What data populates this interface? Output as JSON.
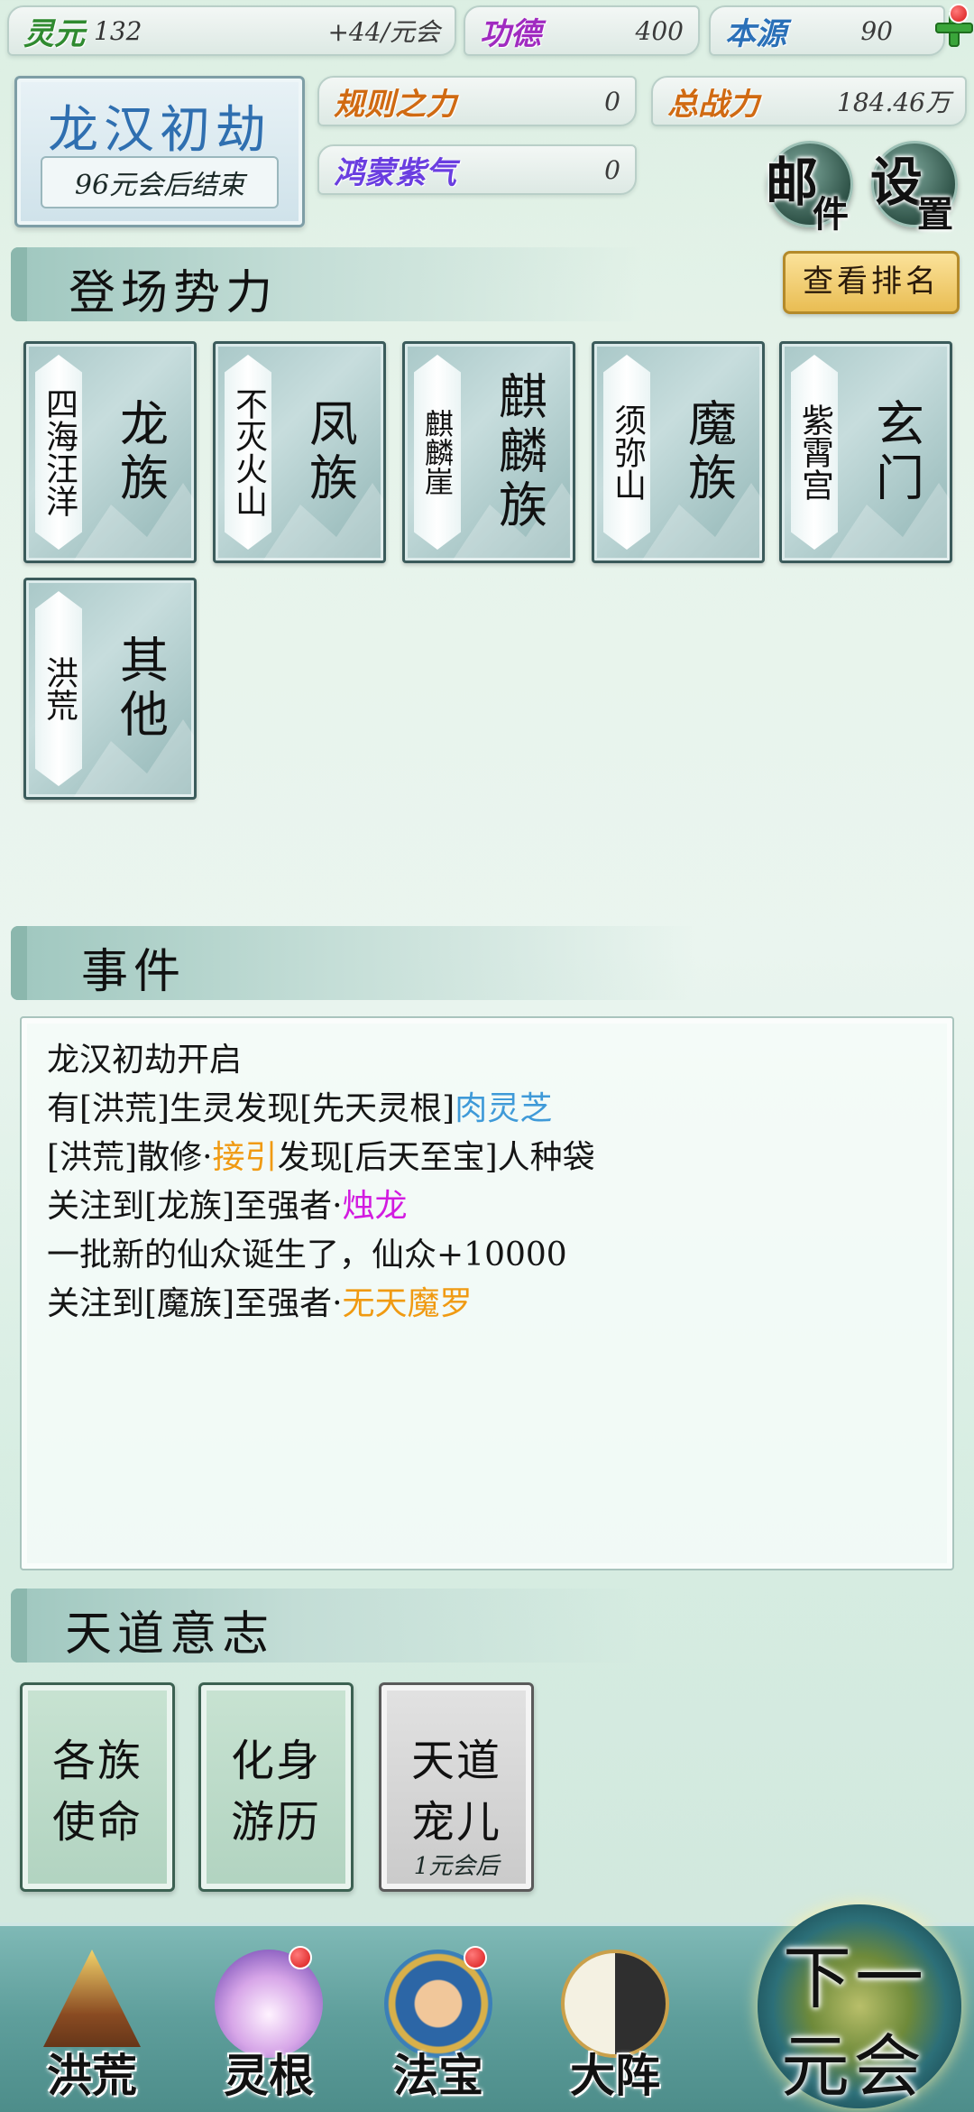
{
  "top": {
    "lingyuan": {
      "label": "灵元",
      "value": "132",
      "rate": "+44/元会"
    },
    "gongde": {
      "label": "功德",
      "value": "400"
    },
    "benyuan": {
      "label": "本源",
      "value": "90"
    },
    "guize": {
      "label": "规则之力",
      "value": "0"
    },
    "zhanli": {
      "label": "总战力",
      "value": "184.46万"
    },
    "hongmeng": {
      "label": "鸿蒙紫气",
      "value": "0"
    }
  },
  "era": {
    "title": "龙汉初劫",
    "subtitle": "96元会后结束"
  },
  "buttons": {
    "mail": [
      "邮",
      "件"
    ],
    "settings": [
      "设",
      "置"
    ]
  },
  "factions_section": {
    "title": "登场势力",
    "rank_button": "查看排名"
  },
  "factions": [
    {
      "location": "四海汪洋",
      "name": "龙族"
    },
    {
      "location": "不灭火山",
      "name": "凤族"
    },
    {
      "location": "麒麟崖",
      "name": "麒麟族"
    },
    {
      "location": "须弥山",
      "name": "魔族"
    },
    {
      "location": "紫霄宫",
      "name": "玄门"
    },
    {
      "location": "洪荒",
      "name": "其他"
    }
  ],
  "events_section": {
    "title": "事件"
  },
  "events": [
    {
      "parts": [
        {
          "t": "龙汉初劫开启"
        }
      ]
    },
    {
      "parts": [
        {
          "t": "有[洪荒]生灵发现[先天灵根]"
        },
        {
          "t": "肉灵芝",
          "c": "hl-blue"
        }
      ]
    },
    {
      "parts": [
        {
          "t": "[洪荒]散修·"
        },
        {
          "t": "接引",
          "c": "hl-orange"
        },
        {
          "t": "发现[后天至宝]人种袋"
        }
      ]
    },
    {
      "parts": [
        {
          "t": "关注到[龙族]至强者·"
        },
        {
          "t": "烛龙",
          "c": "hl-magenta"
        }
      ]
    },
    {
      "parts": [
        {
          "t": "一批新的仙众诞生了，仙众+10000"
        }
      ]
    },
    {
      "parts": [
        {
          "t": "关注到[魔族]至强者·"
        },
        {
          "t": "无天魔罗",
          "c": "hl-orange"
        }
      ]
    }
  ],
  "will_section": {
    "title": "天道意志"
  },
  "will_cards": [
    {
      "l1": "各族",
      "l2": "使命",
      "cd": ""
    },
    {
      "l1": "化身",
      "l2": "游历",
      "cd": ""
    },
    {
      "l1": "天道",
      "l2": "宠儿",
      "cd": "1元会后"
    }
  ],
  "nav": [
    {
      "label": "洪荒",
      "badge": false
    },
    {
      "label": "灵根",
      "badge": true
    },
    {
      "label": "法宝",
      "badge": true
    },
    {
      "label": "大阵",
      "badge": false
    }
  ],
  "next": {
    "line1": "下一",
    "line2": "元会"
  }
}
